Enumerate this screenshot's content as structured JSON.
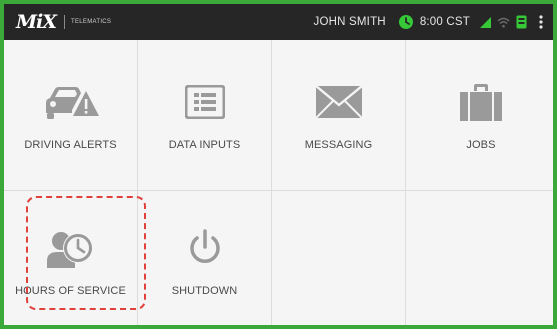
{
  "app": {
    "logo_mark": "MiX",
    "logo_text": "TELEMATICS"
  },
  "status_bar": {
    "user": "JOHN SMITH",
    "time": "8:00 CST",
    "icons": [
      "hos-clock-icon",
      "cell-signal-icon",
      "wifi-icon",
      "device-icon",
      "overflow-menu-icon"
    ]
  },
  "tiles": [
    {
      "label": "DRIVING ALERTS",
      "icon": "car-alert-icon"
    },
    {
      "label": "DATA INPUTS",
      "icon": "form-icon"
    },
    {
      "label": "MESSAGING",
      "icon": "envelope-icon"
    },
    {
      "label": "JOBS",
      "icon": "briefcase-icon"
    },
    {
      "label": "HOURS OF SERVICE",
      "icon": "driver-clock-icon",
      "highlighted": true
    },
    {
      "label": "SHUTDOWN",
      "icon": "power-icon"
    }
  ],
  "colors": {
    "frame_border": "#3aa93a",
    "topbar_bg": "#262626",
    "accent_green": "#37c837",
    "icon_gray": "#9a9a9a",
    "highlight": "#e0413b"
  }
}
